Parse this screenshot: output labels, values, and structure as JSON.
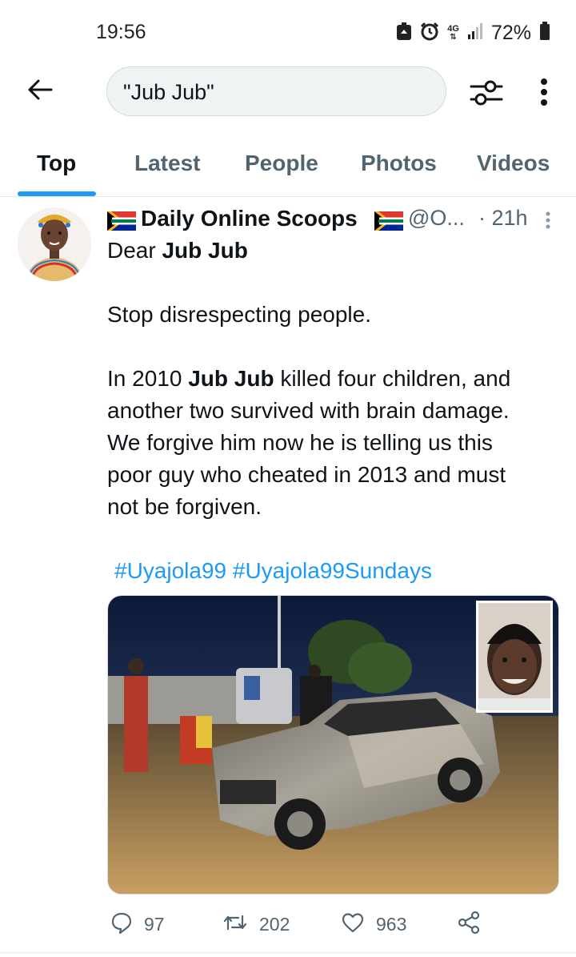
{
  "status_bar": {
    "time": "19:56",
    "network": "4G",
    "battery_percent": "72%",
    "icons": [
      "recycle-icon",
      "alarm-icon",
      "network-4g-icon",
      "signal-icon",
      "battery-icon"
    ]
  },
  "search": {
    "query": "\"Jub Jub\"",
    "icons": [
      "back-arrow-icon",
      "filter-icon",
      "more-vertical-icon"
    ]
  },
  "tabs": [
    {
      "label": "Top",
      "active": true
    },
    {
      "label": "Latest",
      "active": false
    },
    {
      "label": "People",
      "active": false
    },
    {
      "label": "Photos",
      "active": false
    },
    {
      "label": "Videos",
      "active": false
    }
  ],
  "tweet": {
    "display_name": "Daily Online Scoops",
    "handle": "@O...",
    "time": "· 21h",
    "line1_prefix": "Dear ",
    "line1_bold": "Jub Jub",
    "paragraph1": "Stop disrespecting people.",
    "p2_line1_prefix": "In 2010 ",
    "p2_line1_bold": "Jub Jub",
    "p2_line1_suffix": " killed four children, and",
    "p2_line2": "another two survived with brain damage.",
    "p2_line3": "We forgive him now he is telling us this",
    "p2_line4": "poor guy who cheated in 2013 and must",
    "p2_line5": "not be forgiven.",
    "hashtag1": "#Uyajola99",
    "hashtag2": "#Uyajola99Sundays",
    "stats": {
      "replies": "97",
      "retweets": "202",
      "likes": "963"
    }
  },
  "colors": {
    "accent": "#1d9bf0",
    "text_primary": "#0f1419",
    "text_secondary": "#536471",
    "divider": "#e1e8ed"
  }
}
